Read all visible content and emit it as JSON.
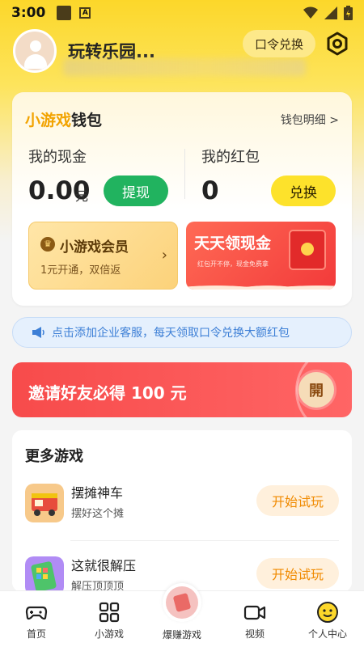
{
  "status": {
    "time": "3:00",
    "badge": "A"
  },
  "profile": {
    "nickname": "玩转乐园..."
  },
  "header": {
    "code_exchange": "口令兑换"
  },
  "wallet": {
    "title_highlight": "小游戏",
    "title_rest": "钱包",
    "detail_link": "钱包明细 >",
    "cash_label": "我的现金",
    "cash_value": "0.00",
    "cash_unit": "元",
    "withdraw": "提现",
    "red_label": "我的红包",
    "red_value": "0",
    "exchange": "兑换"
  },
  "vip": {
    "title": "小游戏会员",
    "subtitle": "1元开通，双倍返",
    "icon": "crown-icon",
    "arrow": "›"
  },
  "cash_banner": {
    "title": "天天领现金",
    "subtitle": "红包开不停，现金免费拿"
  },
  "notice": {
    "text": "点击添加企业客服，每天领取口令兑换大额红包"
  },
  "invite": {
    "text": "邀请好友必得 100 元",
    "open": "開"
  },
  "games": {
    "title": "更多游戏",
    "items": [
      {
        "name": "摆摊神车",
        "desc": "摆好这个摊",
        "action": "开始试玩"
      },
      {
        "name": "这就很解压",
        "desc": "解压顶顶顶",
        "action": "开始试玩"
      }
    ]
  },
  "tabbar": {
    "items": [
      {
        "label": "首页",
        "icon": "gamepad-icon"
      },
      {
        "label": "小游戏",
        "icon": "grid-icon"
      },
      {
        "label": "爆赚游戏",
        "icon": "cash-icon"
      },
      {
        "label": "视频",
        "icon": "video-camera-icon"
      },
      {
        "label": "个人中心",
        "icon": "smiley-icon"
      }
    ]
  },
  "colors": {
    "accent_yellow": "#fcd72a",
    "green": "#21b35f",
    "red": "#f74b4b",
    "orange": "#f08a00"
  }
}
